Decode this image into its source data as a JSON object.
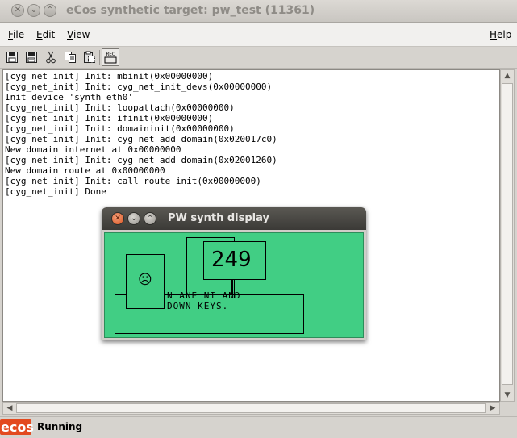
{
  "window": {
    "title": "eCos synthetic target: pw_test (11361)",
    "background_titles": [
      "",
      "",
      "",
      ""
    ]
  },
  "menu": {
    "file": "File",
    "edit": "Edit",
    "view": "View",
    "help": "Help"
  },
  "toolbar": {
    "icons": [
      "save-icon",
      "save-as-icon",
      "cut-icon",
      "copy-icon",
      "paste-icon",
      "record-icon"
    ]
  },
  "log_text": "[cyg_net_init] Init: mbinit(0x00000000)\n[cyg_net_init] Init: cyg_net_init_devs(0x00000000)\nInit device 'synth_eth0'\n[cyg_net_init] Init: loopattach(0x00000000)\n[cyg_net_init] Init: ifinit(0x00000000)\n[cyg_net_init] Init: domaininit(0x00000000)\n[cyg_net_init] Init: cyg_net_add_domain(0x020017c0)\nNew domain internet at 0x00000000\n[cyg_net_init] Init: cyg_net_add_domain(0x02001260)\nNew domain route at 0x00000000\n[cyg_net_init] Init: call_route_init(0x00000000)\n[cyg_net_init] Done",
  "status": {
    "logo_text": "ecos",
    "text": "Running"
  },
  "synth_display": {
    "title": "PW synth display",
    "counter": "249",
    "face": "☹",
    "text_line1": "N ANE NI  AND",
    "text_line2": "DOWN KEYS.",
    "lcd_color": "#41ce84"
  }
}
